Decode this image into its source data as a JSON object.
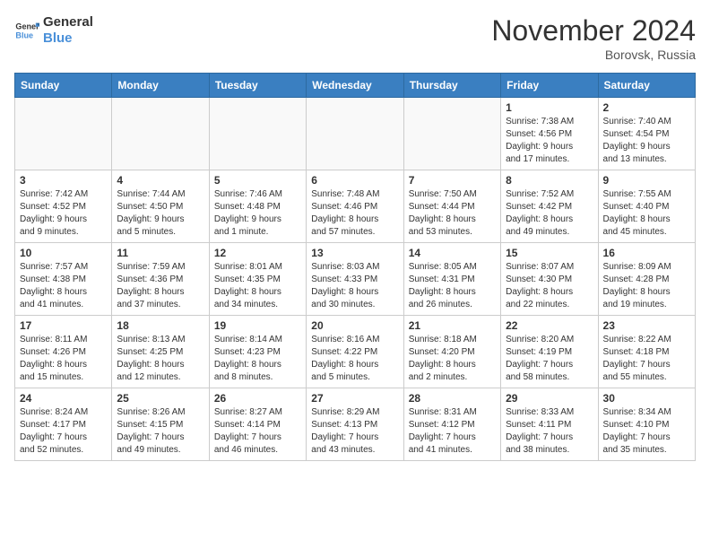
{
  "header": {
    "logo_line1": "General",
    "logo_line2": "Blue",
    "month": "November 2024",
    "location": "Borovsk, Russia"
  },
  "weekdays": [
    "Sunday",
    "Monday",
    "Tuesday",
    "Wednesday",
    "Thursday",
    "Friday",
    "Saturday"
  ],
  "weeks": [
    [
      {
        "day": "",
        "info": ""
      },
      {
        "day": "",
        "info": ""
      },
      {
        "day": "",
        "info": ""
      },
      {
        "day": "",
        "info": ""
      },
      {
        "day": "",
        "info": ""
      },
      {
        "day": "1",
        "info": "Sunrise: 7:38 AM\nSunset: 4:56 PM\nDaylight: 9 hours\nand 17 minutes."
      },
      {
        "day": "2",
        "info": "Sunrise: 7:40 AM\nSunset: 4:54 PM\nDaylight: 9 hours\nand 13 minutes."
      }
    ],
    [
      {
        "day": "3",
        "info": "Sunrise: 7:42 AM\nSunset: 4:52 PM\nDaylight: 9 hours\nand 9 minutes."
      },
      {
        "day": "4",
        "info": "Sunrise: 7:44 AM\nSunset: 4:50 PM\nDaylight: 9 hours\nand 5 minutes."
      },
      {
        "day": "5",
        "info": "Sunrise: 7:46 AM\nSunset: 4:48 PM\nDaylight: 9 hours\nand 1 minute."
      },
      {
        "day": "6",
        "info": "Sunrise: 7:48 AM\nSunset: 4:46 PM\nDaylight: 8 hours\nand 57 minutes."
      },
      {
        "day": "7",
        "info": "Sunrise: 7:50 AM\nSunset: 4:44 PM\nDaylight: 8 hours\nand 53 minutes."
      },
      {
        "day": "8",
        "info": "Sunrise: 7:52 AM\nSunset: 4:42 PM\nDaylight: 8 hours\nand 49 minutes."
      },
      {
        "day": "9",
        "info": "Sunrise: 7:55 AM\nSunset: 4:40 PM\nDaylight: 8 hours\nand 45 minutes."
      }
    ],
    [
      {
        "day": "10",
        "info": "Sunrise: 7:57 AM\nSunset: 4:38 PM\nDaylight: 8 hours\nand 41 minutes."
      },
      {
        "day": "11",
        "info": "Sunrise: 7:59 AM\nSunset: 4:36 PM\nDaylight: 8 hours\nand 37 minutes."
      },
      {
        "day": "12",
        "info": "Sunrise: 8:01 AM\nSunset: 4:35 PM\nDaylight: 8 hours\nand 34 minutes."
      },
      {
        "day": "13",
        "info": "Sunrise: 8:03 AM\nSunset: 4:33 PM\nDaylight: 8 hours\nand 30 minutes."
      },
      {
        "day": "14",
        "info": "Sunrise: 8:05 AM\nSunset: 4:31 PM\nDaylight: 8 hours\nand 26 minutes."
      },
      {
        "day": "15",
        "info": "Sunrise: 8:07 AM\nSunset: 4:30 PM\nDaylight: 8 hours\nand 22 minutes."
      },
      {
        "day": "16",
        "info": "Sunrise: 8:09 AM\nSunset: 4:28 PM\nDaylight: 8 hours\nand 19 minutes."
      }
    ],
    [
      {
        "day": "17",
        "info": "Sunrise: 8:11 AM\nSunset: 4:26 PM\nDaylight: 8 hours\nand 15 minutes."
      },
      {
        "day": "18",
        "info": "Sunrise: 8:13 AM\nSunset: 4:25 PM\nDaylight: 8 hours\nand 12 minutes."
      },
      {
        "day": "19",
        "info": "Sunrise: 8:14 AM\nSunset: 4:23 PM\nDaylight: 8 hours\nand 8 minutes."
      },
      {
        "day": "20",
        "info": "Sunrise: 8:16 AM\nSunset: 4:22 PM\nDaylight: 8 hours\nand 5 minutes."
      },
      {
        "day": "21",
        "info": "Sunrise: 8:18 AM\nSunset: 4:20 PM\nDaylight: 8 hours\nand 2 minutes."
      },
      {
        "day": "22",
        "info": "Sunrise: 8:20 AM\nSunset: 4:19 PM\nDaylight: 7 hours\nand 58 minutes."
      },
      {
        "day": "23",
        "info": "Sunrise: 8:22 AM\nSunset: 4:18 PM\nDaylight: 7 hours\nand 55 minutes."
      }
    ],
    [
      {
        "day": "24",
        "info": "Sunrise: 8:24 AM\nSunset: 4:17 PM\nDaylight: 7 hours\nand 52 minutes."
      },
      {
        "day": "25",
        "info": "Sunrise: 8:26 AM\nSunset: 4:15 PM\nDaylight: 7 hours\nand 49 minutes."
      },
      {
        "day": "26",
        "info": "Sunrise: 8:27 AM\nSunset: 4:14 PM\nDaylight: 7 hours\nand 46 minutes."
      },
      {
        "day": "27",
        "info": "Sunrise: 8:29 AM\nSunset: 4:13 PM\nDaylight: 7 hours\nand 43 minutes."
      },
      {
        "day": "28",
        "info": "Sunrise: 8:31 AM\nSunset: 4:12 PM\nDaylight: 7 hours\nand 41 minutes."
      },
      {
        "day": "29",
        "info": "Sunrise: 8:33 AM\nSunset: 4:11 PM\nDaylight: 7 hours\nand 38 minutes."
      },
      {
        "day": "30",
        "info": "Sunrise: 8:34 AM\nSunset: 4:10 PM\nDaylight: 7 hours\nand 35 minutes."
      }
    ]
  ]
}
